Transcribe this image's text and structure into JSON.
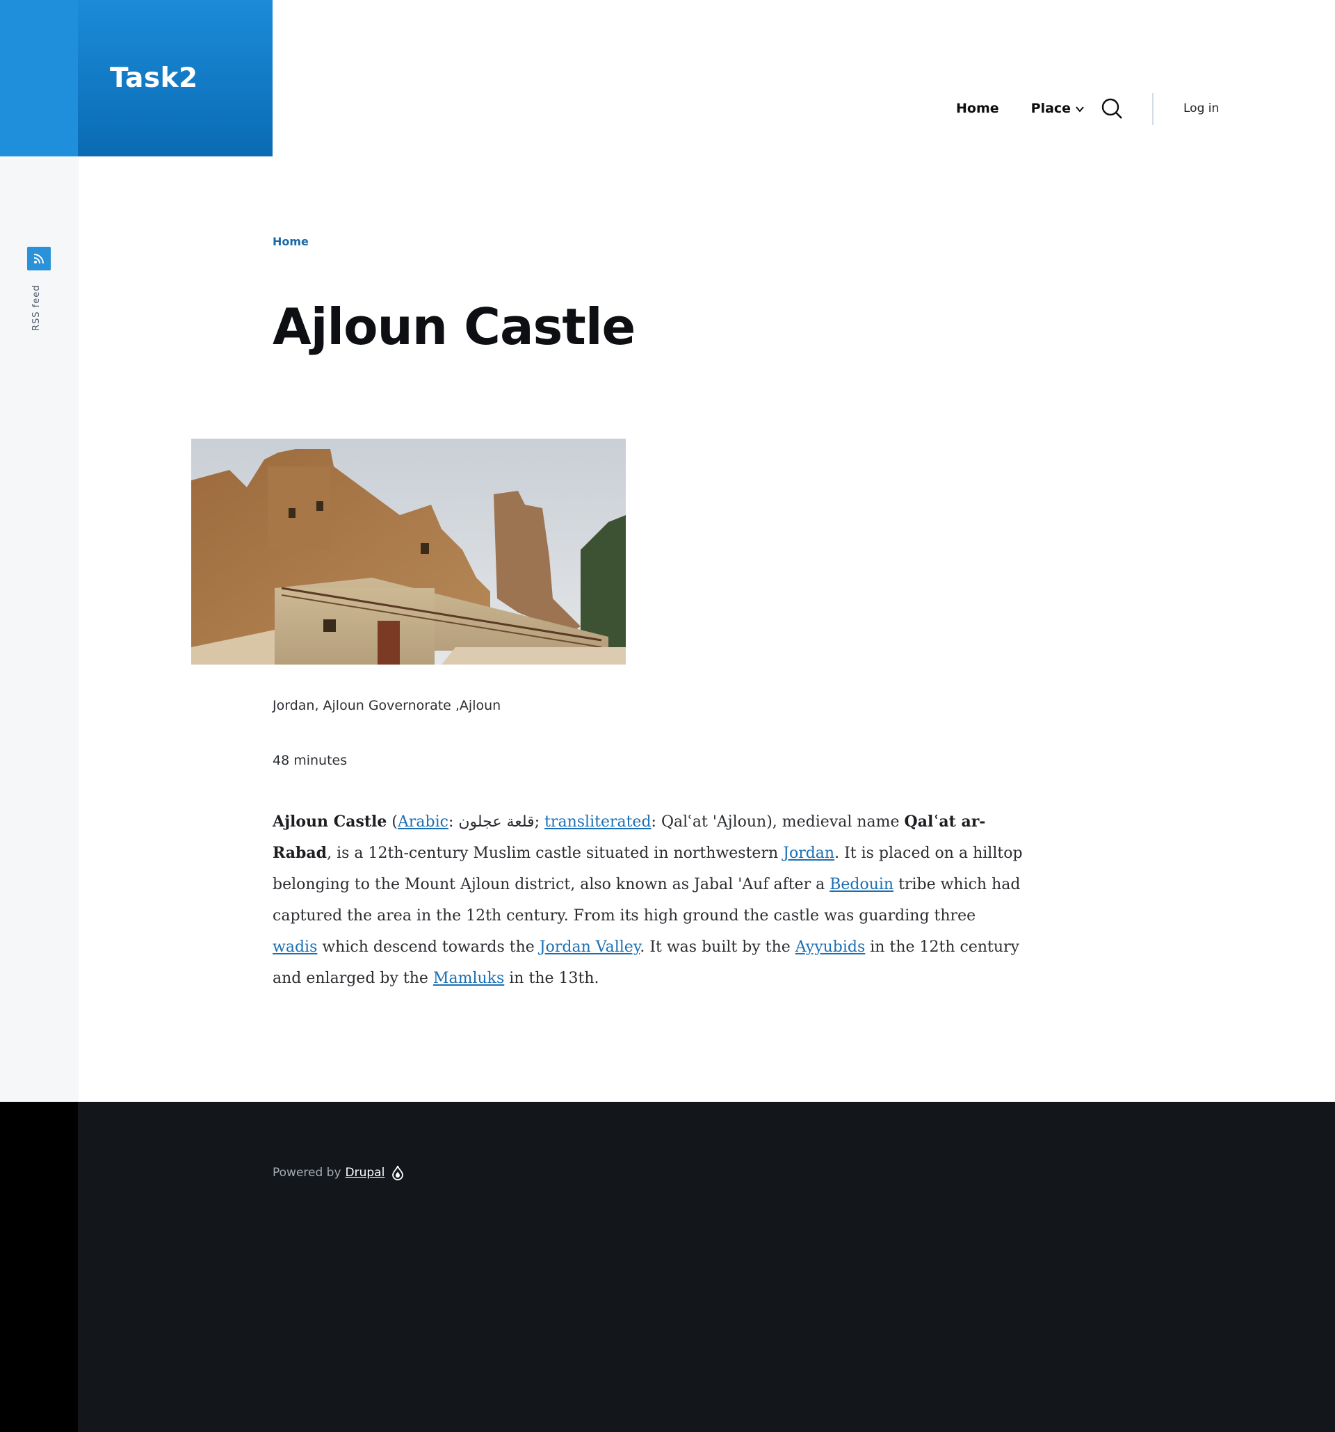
{
  "site": {
    "name": "Task2"
  },
  "nav": {
    "home": "Home",
    "place": "Place",
    "login": "Log in",
    "search_icon": "search-icon"
  },
  "rss": {
    "label": "RSS feed"
  },
  "breadcrumb": {
    "home": "Home"
  },
  "page": {
    "title": "Ajloun Castle"
  },
  "fields": {
    "location": "Jordan, Ajloun Governorate ,Ajloun",
    "duration": "48 minutes"
  },
  "body": {
    "p1_bold": "Ajloun Castle",
    "p1_open": " (",
    "link_arabic": "Arabic",
    "arabic_text": ": قلعة عجلون; ",
    "link_transliterated": "transliterated",
    "translit_text": ": Qalʿat 'Ajloun), medieval name ",
    "bold_rabad": "Qalʿat ar-Rabad",
    "t1": ", is a 12th-century Muslim castle situated in northwestern ",
    "link_jordan": "Jordan",
    "t2": ". It is placed on a hilltop belonging to the Mount Ajloun district, also known as Jabal 'Auf after a ",
    "link_bedouin": "Bedouin",
    "t3": " tribe which had captured the area in the 12th century. From its high ground the castle was guarding three ",
    "link_wadis": "wadis",
    "t4": " which descend towards the ",
    "link_jordan_valley": "Jordan Valley",
    "t5": ". It was built by the ",
    "link_ayyubids": "Ayyubids",
    "t6": " in the 12th century and enlarged by the ",
    "link_mamluks": "Mamluks",
    "t7": " in the 13th."
  },
  "footer": {
    "powered_by": "Powered by",
    "drupal": "Drupal"
  },
  "colors": {
    "brand": "#0a6bb4",
    "link": "#1a6fb4",
    "footer_bg": "#13171c"
  }
}
